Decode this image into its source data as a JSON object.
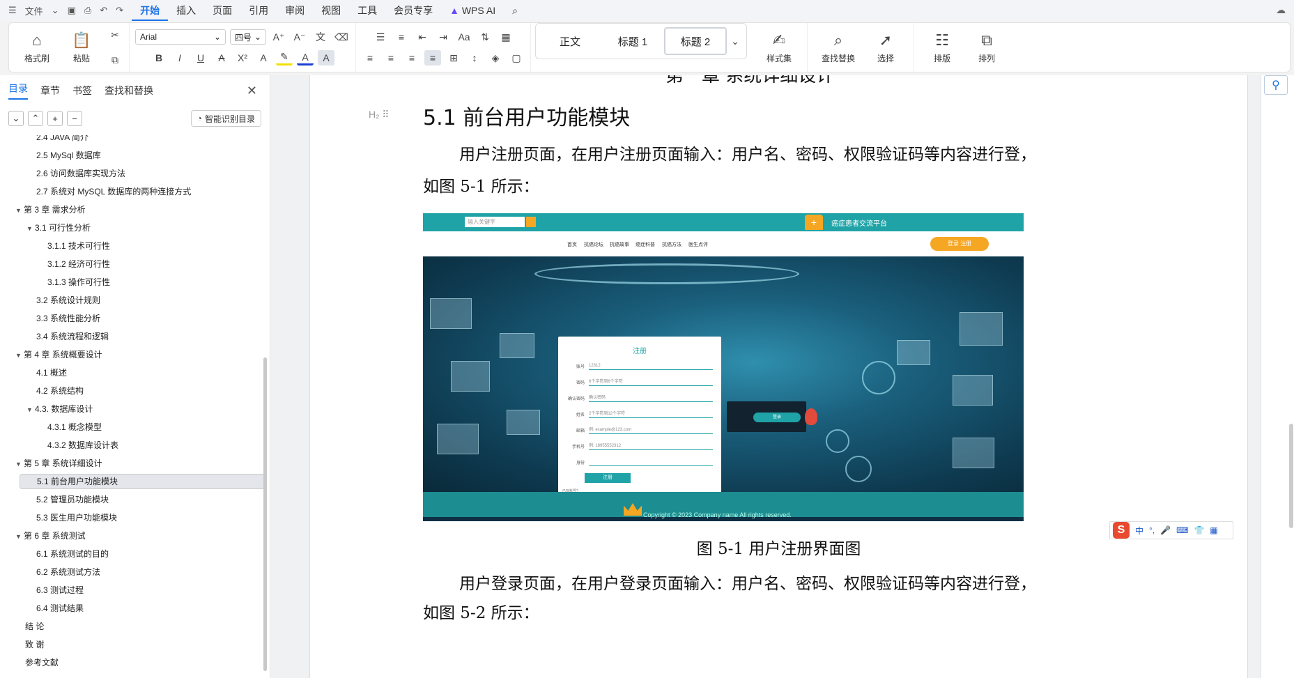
{
  "menubar": {
    "menu_icon": "hamburger-icon",
    "file": "文件",
    "tabs": [
      "开始",
      "插入",
      "页面",
      "引用",
      "审阅",
      "视图",
      "工具",
      "会员专享"
    ],
    "wps_ai": "WPS AI"
  },
  "ribbon": {
    "format_painter": "格式刷",
    "paste": "粘贴",
    "font_name": "Arial",
    "font_size": "四号",
    "styles": [
      "正文",
      "标题 1",
      "标题 2"
    ],
    "style_set": "样式集",
    "find_replace": "查找替换",
    "select": "选择",
    "layout": "排版",
    "arrange": "排列"
  },
  "nav": {
    "tabs": [
      "目录",
      "章节",
      "书签",
      "查找和替换"
    ],
    "smart_toc": "智能识别目录",
    "toc": [
      {
        "text": "2.4 JAVA 简介",
        "level": 2,
        "arrow": false
      },
      {
        "text": "2.5 MySql 数据库",
        "level": 2,
        "arrow": false
      },
      {
        "text": "2.6 访问数据库实现方法",
        "level": 2,
        "arrow": false
      },
      {
        "text": "2.7 系统对 MySQL 数据库的两种连接方式",
        "level": 2,
        "arrow": false
      },
      {
        "text": "第 3 章 需求分析",
        "level": 1,
        "arrow": true
      },
      {
        "text": "3.1 可行性分析",
        "level": 2,
        "arrow": true
      },
      {
        "text": "3.1.1 技术可行性",
        "level": 3,
        "arrow": false
      },
      {
        "text": "3.1.2 经济可行性",
        "level": 3,
        "arrow": false
      },
      {
        "text": "3.1.3 操作可行性",
        "level": 3,
        "arrow": false
      },
      {
        "text": "3.2 系统设计规则",
        "level": 2,
        "arrow": false
      },
      {
        "text": "3.3 系统性能分析",
        "level": 2,
        "arrow": false
      },
      {
        "text": "3.4 系统流程和逻辑",
        "level": 2,
        "arrow": false
      },
      {
        "text": "第 4 章 系统概要设计",
        "level": 1,
        "arrow": true
      },
      {
        "text": "4.1 概述",
        "level": 2,
        "arrow": false
      },
      {
        "text": "4.2 系统结构",
        "level": 2,
        "arrow": false
      },
      {
        "text": "4.3. 数据库设计",
        "level": 2,
        "arrow": true
      },
      {
        "text": "4.3.1 概念模型",
        "level": 3,
        "arrow": false
      },
      {
        "text": "4.3.2 数据库设计表",
        "level": 3,
        "arrow": false
      },
      {
        "text": "第 5 章 系统详细设计",
        "level": 1,
        "arrow": true
      },
      {
        "text": "5.1 前台用户功能模块",
        "level": 2,
        "arrow": false,
        "selected": true
      },
      {
        "text": "5.2 管理员功能模块",
        "level": 2,
        "arrow": false
      },
      {
        "text": "5.3 医生用户功能模块",
        "level": 2,
        "arrow": false
      },
      {
        "text": "第 6 章 系统测试",
        "level": 1,
        "arrow": true
      },
      {
        "text": "6.1 系统测试的目的",
        "level": 2,
        "arrow": false
      },
      {
        "text": "6.2 系统测试方法",
        "level": 2,
        "arrow": false
      },
      {
        "text": "6.3 测试过程",
        "level": 2,
        "arrow": false
      },
      {
        "text": "6.4 测试结果",
        "level": 2,
        "arrow": false
      },
      {
        "text": "结 论",
        "level": 1,
        "arrow": false
      },
      {
        "text": "致 谢",
        "level": 1,
        "arrow": false
      },
      {
        "text": "参考文献",
        "level": 1,
        "arrow": false
      }
    ]
  },
  "doc": {
    "cut_title": "第一章 系统详细设计",
    "heading_mark": "H₂",
    "heading": "5.1 前台用户功能模块",
    "para1_line1": "用户注册页面，在用户注册页面输入：用户名、密码、权限验证码等内容进行登，",
    "para1_line2": "如图 5-1 所示：",
    "caption1": "图 5-1 用户注册界面图",
    "para2_line1": "用户登录页面，在用户登录页面输入：用户名、密码、权限验证码等内容进行登，",
    "para2_line2": "如图 5-2 所示："
  },
  "figure": {
    "search_placeholder": "输入关键字",
    "site_title": "癌症患者交流平台",
    "nav_items": [
      "首页",
      "抗癌论坛",
      "抗癌故事",
      "癌症科普",
      "抗癌方法",
      "医生点评"
    ],
    "login_btn": "登录 注册",
    "form_title": "注册",
    "fields": [
      {
        "label": "账号",
        "value": "12312"
      },
      {
        "label": "密码",
        "value": "6个字符到6个字符"
      },
      {
        "label": "确认密码",
        "value": "确认密码"
      },
      {
        "label": "姓名",
        "value": "2个字符到12个字符"
      },
      {
        "label": "邮箱",
        "value": "例: example@123.com"
      },
      {
        "label": "手机号",
        "value": "例: 18955552312"
      },
      {
        "label": "身份",
        "value": ""
      }
    ],
    "submit": "注册",
    "small_text": "已有账号?",
    "card_btn": "登录",
    "copyright": "Copyright © 2023 Company name All rights reserved."
  },
  "ime": {
    "label": "中"
  }
}
